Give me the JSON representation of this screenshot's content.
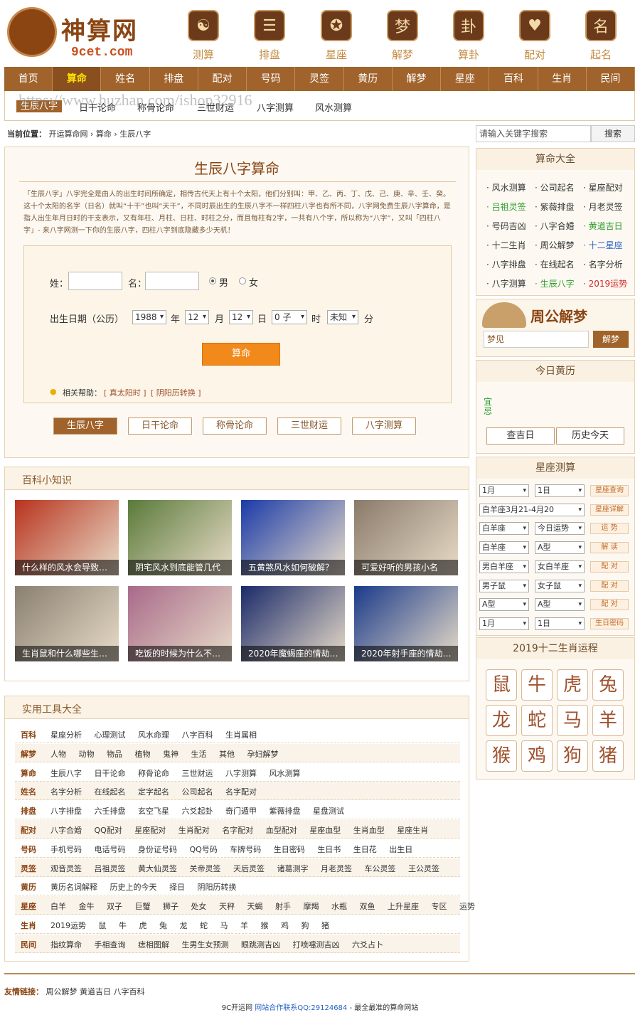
{
  "logo": {
    "brand": "神算网",
    "sub": "9cet.com"
  },
  "top_nav": [
    {
      "label": "测算",
      "glyph": "☯"
    },
    {
      "label": "排盘",
      "glyph": "☰"
    },
    {
      "label": "星座",
      "glyph": "✪"
    },
    {
      "label": "解梦",
      "glyph": "梦"
    },
    {
      "label": "算卦",
      "glyph": "卦"
    },
    {
      "label": "配对",
      "glyph": "♥"
    },
    {
      "label": "起名",
      "glyph": "名"
    }
  ],
  "main_nav": [
    "首页",
    "算命",
    "姓名",
    "排盘",
    "配对",
    "号码",
    "灵签",
    "黄历",
    "解梦",
    "星座",
    "百科",
    "生肖",
    "民间"
  ],
  "sub_nav": [
    "生辰八字",
    "日干论命",
    "称骨论命",
    "三世财运",
    "八字测算",
    "风水测算"
  ],
  "watermark": "https://www.huzhan.com/ishop32916",
  "breadcrumb": {
    "prefix": "当前位置：",
    "items": [
      "开运算命网",
      "算命",
      "生辰八字"
    ],
    "sep": "›"
  },
  "bazi": {
    "title": "生辰八字算命",
    "desc": "「生辰八字」八字完全是由人的出生时间所确定，相传古代天上有十个太阳，他们分别叫：甲、乙、丙、丁、戊、己、庚、辛、壬、癸。这十个太阳的名字（日名）就叫“十干”也叫“天干”，不同时辰出生的生辰八字不一样四柱八字也有所不同，八字网免费生辰八字算命，是指人出生年月日时的干支表示，又有年柱、月柱、日柱、时柱之分，而且每柱有2字，一共有八个字，所以称为“八字”，又叫「四柱八字」- 来八字网测一下你的生辰八字，四柱八字到底隐藏多少天机！",
    "form": {
      "surname_label": "姓：",
      "name_label": "名：",
      "male": "男",
      "female": "女",
      "date_label": "出生日期（公历）",
      "year": "1988",
      "year_unit": "年",
      "month": "12",
      "month_unit": "月",
      "day": "12",
      "day_unit": "日",
      "hour": "0 子",
      "hour_unit": "时",
      "minute": "未知",
      "minute_unit": "分",
      "submit": "算命",
      "help_label": "相关帮助：",
      "help1": "[ 真太阳时 ]",
      "help2": "[ 阴阳历转换 ]"
    },
    "tabs": [
      "生辰八字",
      "日干论命",
      "称骨论命",
      "三世财运",
      "八字测算"
    ]
  },
  "baike": {
    "title": "百科小知识",
    "items": [
      {
        "caption": "什么样的风水会导致…",
        "color": "#b8331e"
      },
      {
        "caption": "阴宅风水到底能管几代",
        "color": "#5a7a3a"
      },
      {
        "caption": "五黄煞风水如何破解？",
        "color": "#1a3aa8"
      },
      {
        "caption": "可爱好听的男孩小名",
        "color": "#8a7a6a"
      },
      {
        "caption": "生肖鼠和什么哪些生…",
        "color": "#8a8070"
      },
      {
        "caption": "吃饭的时候为什么不…",
        "color": "#a86a8a"
      },
      {
        "caption": "2020年魔蝎座的情劫…",
        "color": "#1a2a6a"
      },
      {
        "caption": "2020年射手座的情劫…",
        "color": "#1a3a8a"
      }
    ]
  },
  "tools": {
    "title": "实用工具大全",
    "rows": [
      {
        "k": "百科",
        "v": "星座分析 心理测试 风水命理 八字百科 生肖属相"
      },
      {
        "k": "解梦",
        "v": "人物 动物 物品 植物 鬼神 生活 其他 孕妇解梦"
      },
      {
        "k": "算命",
        "v": "生辰八字 日干论命 称骨论命 三世财运 八字测算 风水测算"
      },
      {
        "k": "姓名",
        "v": "名字分析 在线起名 定字起名 公司起名 名字配对"
      },
      {
        "k": "排盘",
        "v": "八字排盘 六壬排盘 玄空飞星 六爻起卦 奇门遁甲 紫薇排盘 星盘测试"
      },
      {
        "k": "配对",
        "v": "八字合婚 QQ配对 星座配对 生肖配对 名字配对 血型配对 星座血型 生肖血型 星座生肖"
      },
      {
        "k": "号码",
        "v": "手机号码 电话号码 身份证号码 QQ号码 车牌号码 生日密码 生日书 生日花 出生日"
      },
      {
        "k": "灵签",
        "v": "观音灵签 吕祖灵签 黄大仙灵签 关帝灵签 天后灵签 诸葛测字 月老灵签 车公灵签 王公灵签"
      },
      {
        "k": "黄历",
        "v": "黄历名词解释 历史上的今天 择日 阴阳历转换"
      },
      {
        "k": "星座",
        "v": "白羊 金牛 双子 巨蟹 狮子 处女 天秤 天蝎 射手 摩羯 水瓶 双鱼 上升星座 专区 运势"
      },
      {
        "k": "生肖",
        "v": "2019运势 鼠 牛 虎 兔 龙 蛇 马 羊 猴 鸡 狗 猪"
      },
      {
        "k": "民间",
        "v": "指纹算命 手相查询 痣相图解 生男生女预测 眼跳测吉凶 打喷嚏测吉凶 六爻占卜"
      }
    ]
  },
  "search": {
    "placeholder": "请输入关键字搜索",
    "button": "搜索"
  },
  "suanming": {
    "title": "算命大全",
    "items": [
      {
        "t": "风水测算",
        "c": ""
      },
      {
        "t": "公司起名",
        "c": ""
      },
      {
        "t": "星座配对",
        "c": ""
      },
      {
        "t": "吕祖灵签",
        "c": "g"
      },
      {
        "t": "紫薇排盘",
        "c": ""
      },
      {
        "t": "月老灵签",
        "c": ""
      },
      {
        "t": "号码吉凶",
        "c": ""
      },
      {
        "t": "八字合婚",
        "c": ""
      },
      {
        "t": "黄道吉日",
        "c": "g"
      },
      {
        "t": "十二生肖",
        "c": ""
      },
      {
        "t": "周公解梦",
        "c": ""
      },
      {
        "t": "十二星座",
        "c": "b"
      },
      {
        "t": "八字排盘",
        "c": ""
      },
      {
        "t": "在线起名",
        "c": ""
      },
      {
        "t": "名字分析",
        "c": ""
      },
      {
        "t": "八字测算",
        "c": ""
      },
      {
        "t": "生辰八字",
        "c": "g"
      },
      {
        "t": "2019运势",
        "c": "r"
      }
    ]
  },
  "zgjm": {
    "title": "周公解梦",
    "placeholder": "梦见",
    "button": "解梦"
  },
  "huangli": {
    "title": "今日黄历",
    "glyph": "宜忌",
    "btn1": "查吉日",
    "btn2": "历史今天"
  },
  "xzcs": {
    "title": "星座测算",
    "rows": [
      {
        "a": "1月",
        "b": "1日",
        "btn": "星座查询"
      },
      {
        "a": "白羊座3月21-4月20",
        "b": "",
        "btn": "星座详解"
      },
      {
        "a": "白羊座",
        "b": "今日运势",
        "btn": "运 势"
      },
      {
        "a": "白羊座",
        "b": "A型",
        "btn": "解 读"
      },
      {
        "a": "男白羊座",
        "b": "女白羊座",
        "btn": "配 对"
      },
      {
        "a": "男子鼠",
        "b": "女子鼠",
        "btn": "配 对"
      },
      {
        "a": "A型",
        "b": "A型",
        "btn": "配 对"
      },
      {
        "a": "1月",
        "b": "1日",
        "btn": "生日密码"
      }
    ]
  },
  "shengxiao": {
    "title": "2019十二生肖运程",
    "animals": [
      "鼠",
      "牛",
      "虎",
      "兔",
      "龙",
      "蛇",
      "马",
      "羊",
      "猴",
      "鸡",
      "狗",
      "猪"
    ]
  },
  "footer": {
    "links_label": "友情链接：",
    "links": [
      "周公解梦",
      "黄道吉日",
      "八字百科"
    ],
    "copy_a": "9C开运网",
    "copy_b": "网站合作联系QQ:29124684",
    "copy_c": "- 最全最准的算命网站"
  }
}
